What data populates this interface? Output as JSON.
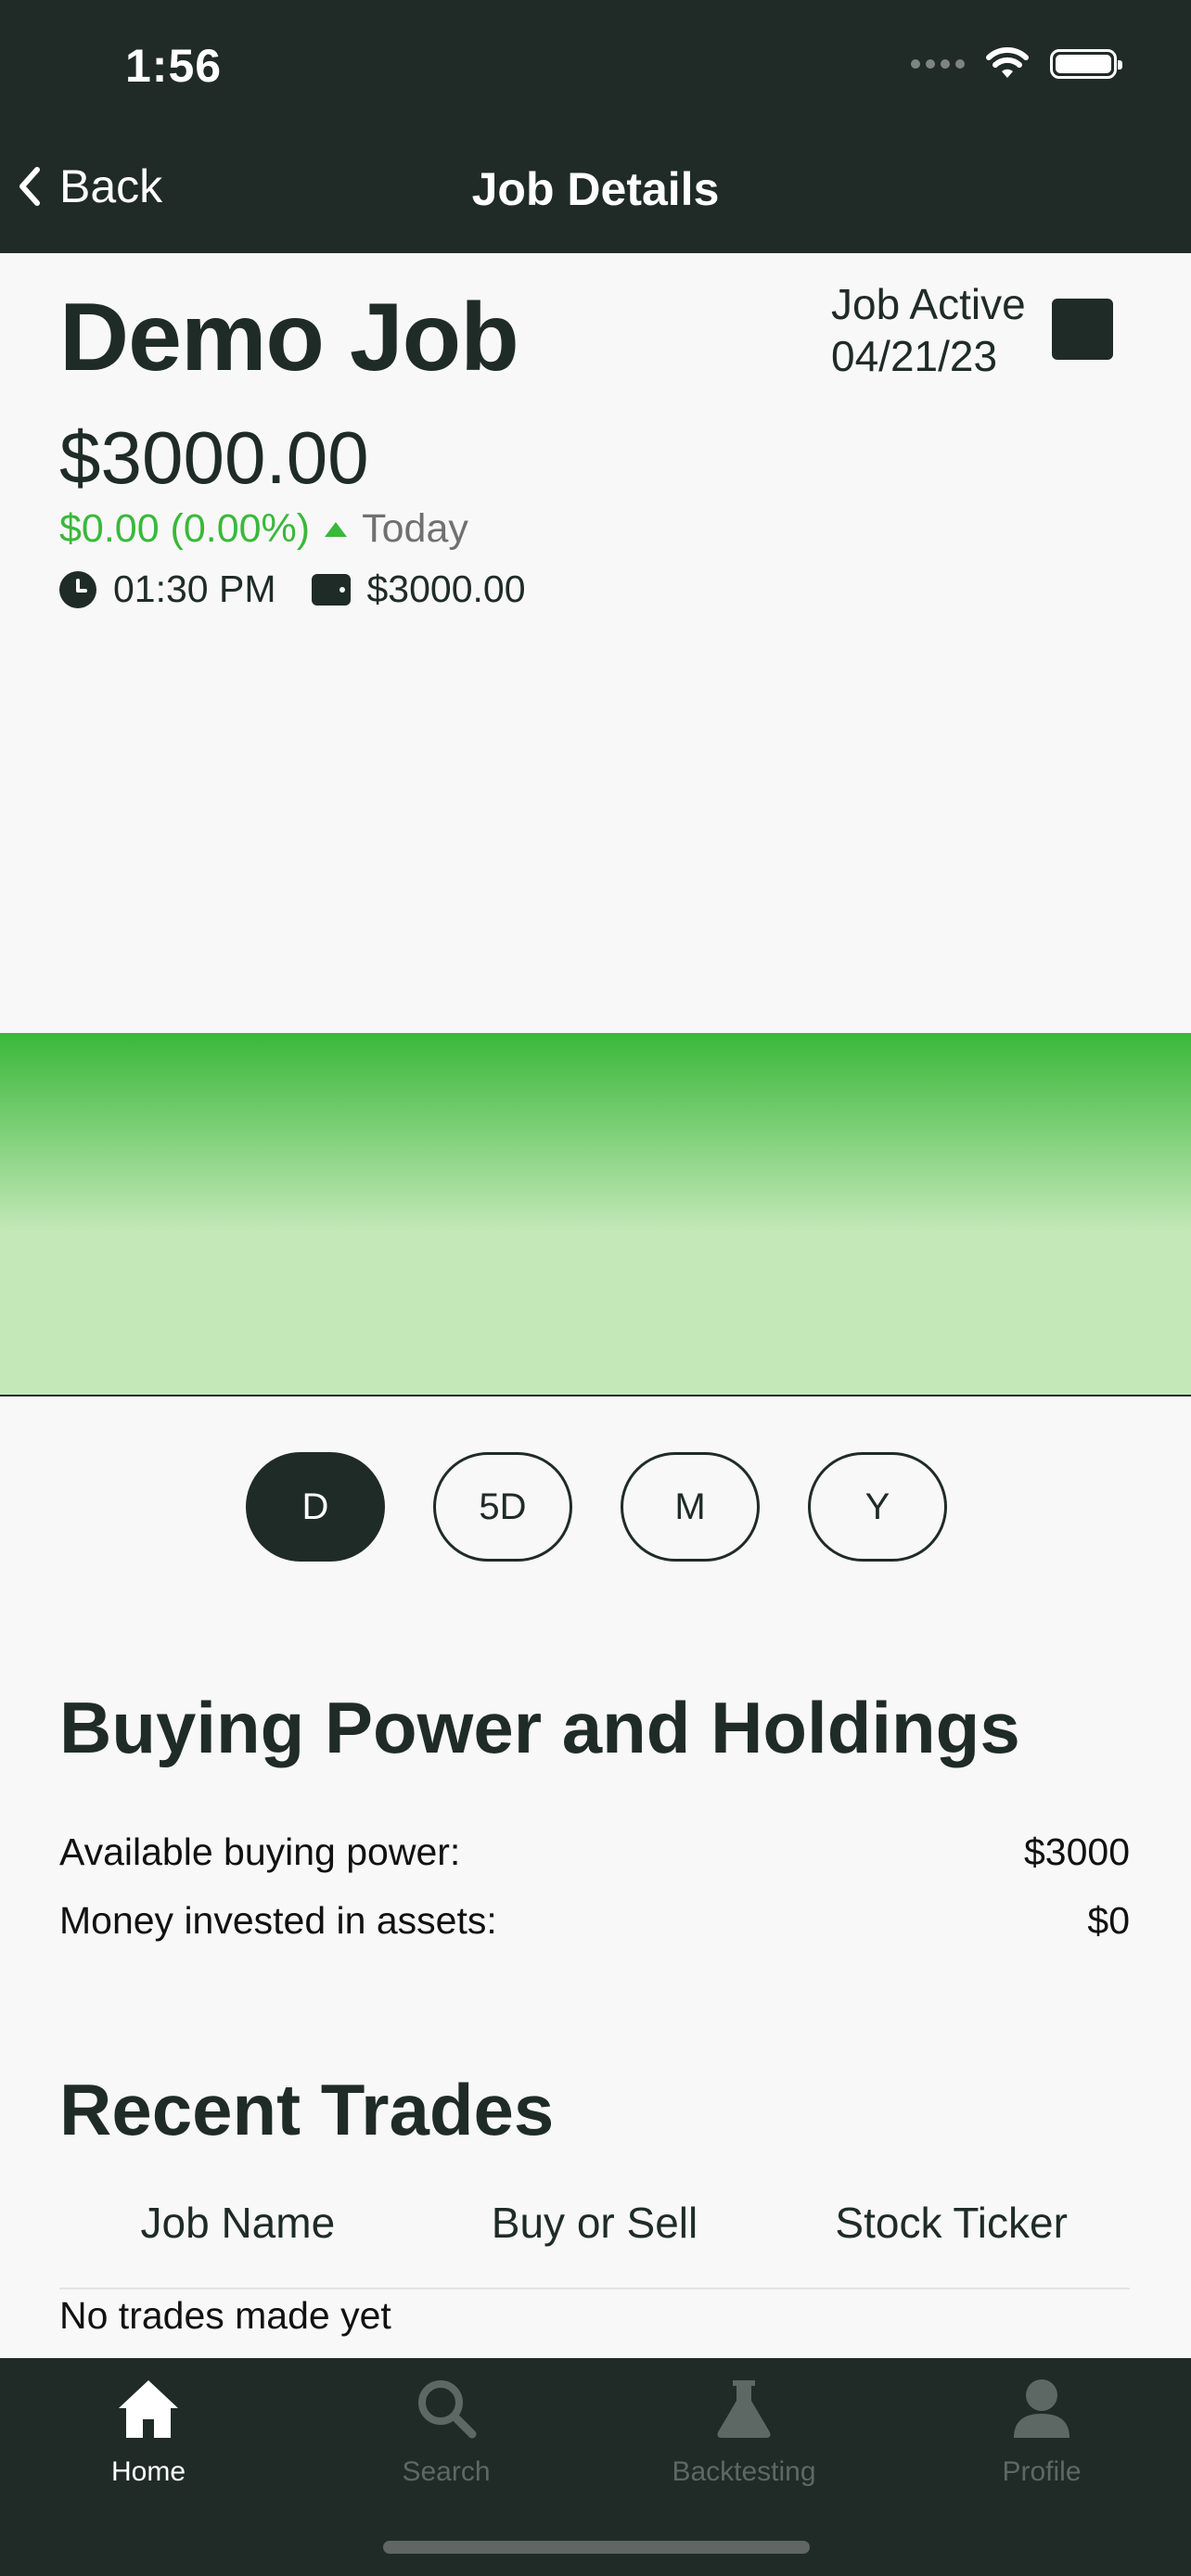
{
  "status_bar": {
    "time": "1:56"
  },
  "nav": {
    "back_label": "Back",
    "title": "Job Details"
  },
  "job": {
    "name": "Demo Job",
    "status_label": "Job Active",
    "start_date": "04/21/23",
    "value": "$3000.00",
    "change": "$0.00 (0.00%)",
    "change_period": "Today",
    "time": "01:30 PM",
    "cash": "$3000.00"
  },
  "chart_data": {
    "type": "area",
    "values": [
      3000,
      3000
    ],
    "color": "#3ab83a"
  },
  "ranges": {
    "items": [
      {
        "label": "D",
        "active": true
      },
      {
        "label": "5D",
        "active": false
      },
      {
        "label": "M",
        "active": false
      },
      {
        "label": "Y",
        "active": false
      }
    ]
  },
  "holdings": {
    "title": "Buying Power and Holdings",
    "buying_power_label": "Available buying power:",
    "buying_power_value": "$3000",
    "invested_label": "Money invested in assets:",
    "invested_value": "$0"
  },
  "trades": {
    "title": "Recent Trades",
    "columns": [
      "Job Name",
      "Buy or Sell",
      "Stock Ticker"
    ],
    "empty_text": "No trades made yet"
  },
  "tabbar": {
    "items": [
      {
        "label": "Home",
        "icon": "home-icon",
        "active": true
      },
      {
        "label": "Search",
        "icon": "search-icon",
        "active": false
      },
      {
        "label": "Backtesting",
        "icon": "flask-icon",
        "active": false
      },
      {
        "label": "Profile",
        "icon": "person-icon",
        "active": false
      }
    ]
  },
  "colors": {
    "header_bg": "#202b28",
    "accent": "#3ab83a",
    "text": "#1f2b27"
  }
}
